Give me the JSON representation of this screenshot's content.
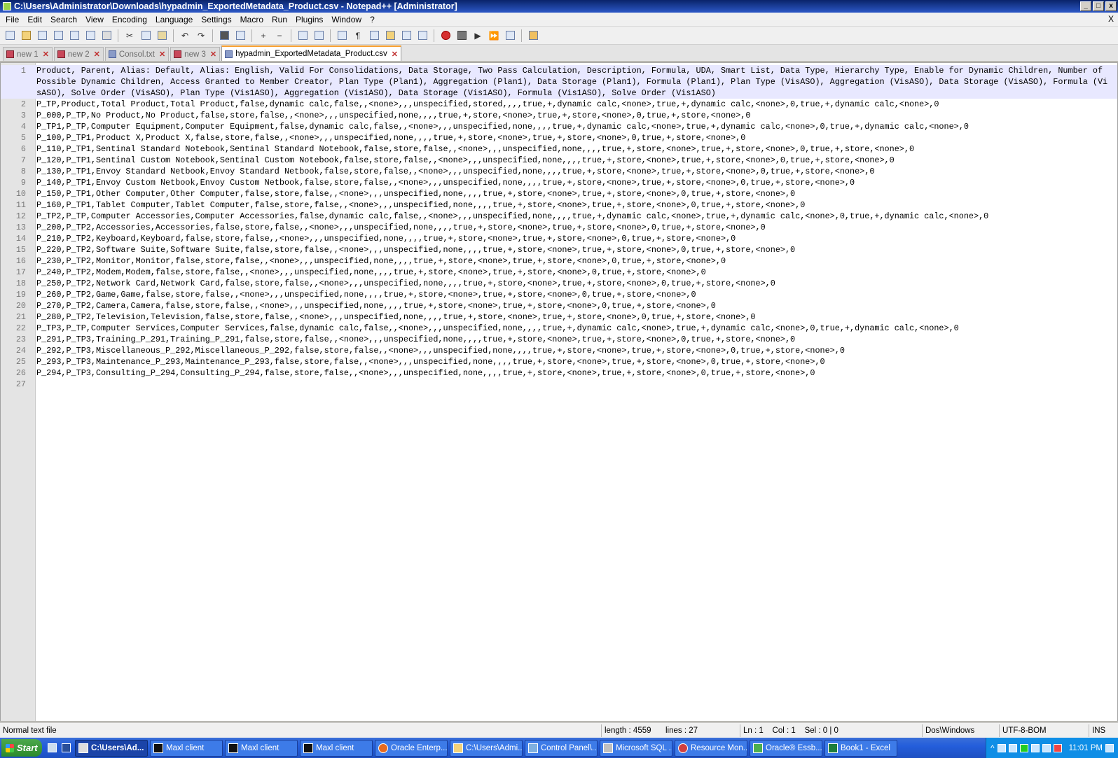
{
  "window": {
    "title": "C:\\Users\\Administrator\\Downloads\\hypadmin_ExportedMetadata_Product.csv - Notepad++ [Administrator]",
    "controls": [
      "_",
      "□",
      "x"
    ]
  },
  "menu": {
    "items": [
      "File",
      "Edit",
      "Search",
      "View",
      "Encoding",
      "Language",
      "Settings",
      "Macro",
      "Run",
      "Plugins",
      "Window",
      "?"
    ],
    "close": "X"
  },
  "tabs": [
    {
      "label": "new 1",
      "active": false
    },
    {
      "label": "new 2",
      "active": false
    },
    {
      "label": "Consol.txt",
      "active": false
    },
    {
      "label": "new 3",
      "active": false
    },
    {
      "label": "hypadmin_ExportedMetadata_Product.csv",
      "active": true
    }
  ],
  "editor": {
    "lines": [
      {
        "n": "1",
        "text": "Product, Parent, Alias: Default, Alias: English, Valid For Consolidations, Data Storage, Two Pass Calculation, Description, Formula, UDA, Smart List, Data Type, Hierarchy Type, Enable for Dynamic Children, Number of Possible Dynamic Children, Access Granted to Member Creator, Plan Type (Plan1), Aggregation (Plan1), Data Storage (Plan1), Formula (Plan1), Plan Type (VisASO), Aggregation (VisASO), Data Storage (VisASO), Formula (VisASO), Solve Order (VisASO), Plan Type (Vis1ASO), Aggregation (Vis1ASO), Data Storage (Vis1ASO), Formula (Vis1ASO), Solve Order (Vis1ASO)"
      },
      {
        "n": "2",
        "text": "P_TP,Product,Total Product,Total Product,false,dynamic calc,false,,<none>,,,unspecified,stored,,,,true,+,dynamic calc,<none>,true,+,dynamic calc,<none>,0,true,+,dynamic calc,<none>,0"
      },
      {
        "n": "3",
        "text": "P_000,P_TP,No Product,No Product,false,store,false,,<none>,,,unspecified,none,,,,true,+,store,<none>,true,+,store,<none>,0,true,+,store,<none>,0"
      },
      {
        "n": "4",
        "text": "P_TP1,P_TP,Computer Equipment,Computer Equipment,false,dynamic calc,false,,<none>,,,unspecified,none,,,,true,+,dynamic calc,<none>,true,+,dynamic calc,<none>,0,true,+,dynamic calc,<none>,0"
      },
      {
        "n": "5",
        "text": "P_100,P_TP1,Product X,Product X,false,store,false,,<none>,,,unspecified,none,,,,true,+,store,<none>,true,+,store,<none>,0,true,+,store,<none>,0"
      },
      {
        "n": "6",
        "text": "P_110,P_TP1,Sentinal Standard Notebook,Sentinal Standard Notebook,false,store,false,,<none>,,,unspecified,none,,,,true,+,store,<none>,true,+,store,<none>,0,true,+,store,<none>,0"
      },
      {
        "n": "7",
        "text": "P_120,P_TP1,Sentinal Custom Notebook,Sentinal Custom Notebook,false,store,false,,<none>,,,unspecified,none,,,,true,+,store,<none>,true,+,store,<none>,0,true,+,store,<none>,0"
      },
      {
        "n": "8",
        "text": "P_130,P_TP1,Envoy Standard Netbook,Envoy Standard Netbook,false,store,false,,<none>,,,unspecified,none,,,,true,+,store,<none>,true,+,store,<none>,0,true,+,store,<none>,0"
      },
      {
        "n": "9",
        "text": "P_140,P_TP1,Envoy Custom Netbook,Envoy Custom Netbook,false,store,false,,<none>,,,unspecified,none,,,,true,+,store,<none>,true,+,store,<none>,0,true,+,store,<none>,0"
      },
      {
        "n": "10",
        "text": "P_150,P_TP1,Other Computer,Other Computer,false,store,false,,<none>,,,unspecified,none,,,,true,+,store,<none>,true,+,store,<none>,0,true,+,store,<none>,0"
      },
      {
        "n": "11",
        "text": "P_160,P_TP1,Tablet Computer,Tablet Computer,false,store,false,,<none>,,,unspecified,none,,,,true,+,store,<none>,true,+,store,<none>,0,true,+,store,<none>,0"
      },
      {
        "n": "12",
        "text": "P_TP2,P_TP,Computer Accessories,Computer Accessories,false,dynamic calc,false,,<none>,,,unspecified,none,,,,true,+,dynamic calc,<none>,true,+,dynamic calc,<none>,0,true,+,dynamic calc,<none>,0"
      },
      {
        "n": "13",
        "text": "P_200,P_TP2,Accessories,Accessories,false,store,false,,<none>,,,unspecified,none,,,,true,+,store,<none>,true,+,store,<none>,0,true,+,store,<none>,0"
      },
      {
        "n": "14",
        "text": "P_210,P_TP2,Keyboard,Keyboard,false,store,false,,<none>,,,unspecified,none,,,,true,+,store,<none>,true,+,store,<none>,0,true,+,store,<none>,0"
      },
      {
        "n": "15",
        "text": "P_220,P_TP2,Software Suite,Software Suite,false,store,false,,<none>,,,unspecified,none,,,,true,+,store,<none>,true,+,store,<none>,0,true,+,store,<none>,0"
      },
      {
        "n": "16",
        "text": "P_230,P_TP2,Monitor,Monitor,false,store,false,,<none>,,,unspecified,none,,,,true,+,store,<none>,true,+,store,<none>,0,true,+,store,<none>,0"
      },
      {
        "n": "17",
        "text": "P_240,P_TP2,Modem,Modem,false,store,false,,<none>,,,unspecified,none,,,,true,+,store,<none>,true,+,store,<none>,0,true,+,store,<none>,0"
      },
      {
        "n": "18",
        "text": "P_250,P_TP2,Network Card,Network Card,false,store,false,,<none>,,,unspecified,none,,,,true,+,store,<none>,true,+,store,<none>,0,true,+,store,<none>,0"
      },
      {
        "n": "19",
        "text": "P_260,P_TP2,Game,Game,false,store,false,,<none>,,,unspecified,none,,,,true,+,store,<none>,true,+,store,<none>,0,true,+,store,<none>,0"
      },
      {
        "n": "20",
        "text": "P_270,P_TP2,Camera,Camera,false,store,false,,<none>,,,unspecified,none,,,,true,+,store,<none>,true,+,store,<none>,0,true,+,store,<none>,0"
      },
      {
        "n": "21",
        "text": "P_280,P_TP2,Television,Television,false,store,false,,<none>,,,unspecified,none,,,,true,+,store,<none>,true,+,store,<none>,0,true,+,store,<none>,0"
      },
      {
        "n": "22",
        "text": "P_TP3,P_TP,Computer Services,Computer Services,false,dynamic calc,false,,<none>,,,unspecified,none,,,,true,+,dynamic calc,<none>,true,+,dynamic calc,<none>,0,true,+,dynamic calc,<none>,0"
      },
      {
        "n": "23",
        "text": "P_291,P_TP3,Training_P_291,Training_P_291,false,store,false,,<none>,,,unspecified,none,,,,true,+,store,<none>,true,+,store,<none>,0,true,+,store,<none>,0"
      },
      {
        "n": "24",
        "text": "P_292,P_TP3,Miscellaneous_P_292,Miscellaneous_P_292,false,store,false,,<none>,,,unspecified,none,,,,true,+,store,<none>,true,+,store,<none>,0,true,+,store,<none>,0"
      },
      {
        "n": "25",
        "text": "P_293,P_TP3,Maintenance_P_293,Maintenance_P_293,false,store,false,,<none>,,,unspecified,none,,,,true,+,store,<none>,true,+,store,<none>,0,true,+,store,<none>,0"
      },
      {
        "n": "26",
        "text": "P_294,P_TP3,Consulting_P_294,Consulting_P_294,false,store,false,,<none>,,,unspecified,none,,,,true,+,store,<none>,true,+,store,<none>,0,true,+,store,<none>,0"
      },
      {
        "n": "27",
        "text": ""
      }
    ]
  },
  "status": {
    "file_type": "Normal text file",
    "length": "length : 4559",
    "lines": "lines : 27",
    "position": "Ln : 1    Col : 1    Sel : 0 | 0",
    "eol": "Dos\\Windows",
    "encoding": "UTF-8-BOM",
    "mode": "INS"
  },
  "taskbar": {
    "start": "Start",
    "tasks": [
      {
        "label": "C:\\Users\\Ad...",
        "active": true
      },
      {
        "label": "Maxl client",
        "active": false
      },
      {
        "label": "Maxl client",
        "active": false
      },
      {
        "label": "Maxl client",
        "active": false
      },
      {
        "label": "Oracle Enterp...",
        "active": false
      },
      {
        "label": "C:\\Users\\Admi...",
        "active": false
      },
      {
        "label": "Control Panel\\...",
        "active": false
      },
      {
        "label": "Microsoft SQL ...",
        "active": false
      },
      {
        "label": "Resource Mon...",
        "active": false
      },
      {
        "label": "Oracle® Essb...",
        "active": false
      },
      {
        "label": "Book1 - Excel",
        "active": false
      }
    ],
    "clock": "11:01 PM"
  }
}
